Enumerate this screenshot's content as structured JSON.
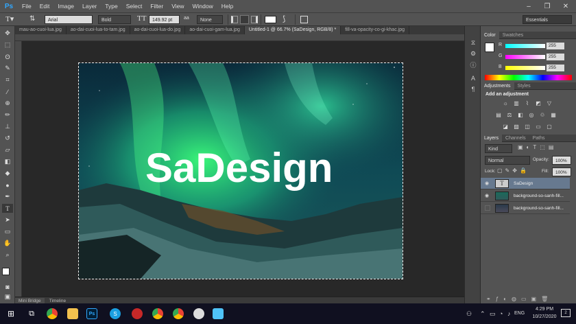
{
  "app": {
    "logo": "Ps",
    "menu": [
      "File",
      "Edit",
      "Image",
      "Layer",
      "Type",
      "Select",
      "Filter",
      "View",
      "Window",
      "Help"
    ]
  },
  "window_controls": [
    "–",
    "❐",
    "✕"
  ],
  "options": {
    "font_family": "Arial",
    "font_style": "Bold",
    "font_size": "149.92 pt",
    "anti_alias_label": "aa",
    "anti_alias": "None",
    "workspace": "Essentials"
  },
  "tabs": [
    "mau-ao-cuoi-lua.jpg",
    "ao-dai-cuoi-lua-to-tam.jpg",
    "ao-dai-cuoi-lua-do.jpg",
    "ao-dai-cuoi-gam-lua.jpg",
    "Untitled-1 @ 66.7% (SaDesign, RGB/8) *",
    "fill-va-opacity-co-gi-khac.jpg"
  ],
  "canvas": {
    "text": "SaDesign"
  },
  "bottom_tabs": [
    "Mini Bridge",
    "Timeline"
  ],
  "color_panel": {
    "tabs": [
      "Color",
      "Swatches"
    ],
    "channels": [
      {
        "label": "R",
        "value": "255"
      },
      {
        "label": "G",
        "value": "255"
      },
      {
        "label": "B",
        "value": "255"
      }
    ]
  },
  "adjustments_panel": {
    "tabs": [
      "Adjustments",
      "Styles"
    ],
    "title": "Add an adjustment"
  },
  "layers_panel": {
    "tabs": [
      "Layers",
      "Channels",
      "Paths"
    ],
    "filter": "Kind",
    "blend_mode": "Normal",
    "opacity_label": "Opacity:",
    "opacity": "100%",
    "lock_label": "Lock:",
    "fill_label": "Fill:",
    "fill": "100%",
    "layers": [
      {
        "name": "SaDesign",
        "type": "text"
      },
      {
        "name": "background-so-sanh-fill...",
        "type": "image"
      },
      {
        "name": "background-so-sanh-fill...",
        "type": "image"
      }
    ]
  },
  "taskbar": {
    "time": "4:29 PM",
    "date": "10/27/2020",
    "lang": "ENG",
    "notifications": "2"
  }
}
